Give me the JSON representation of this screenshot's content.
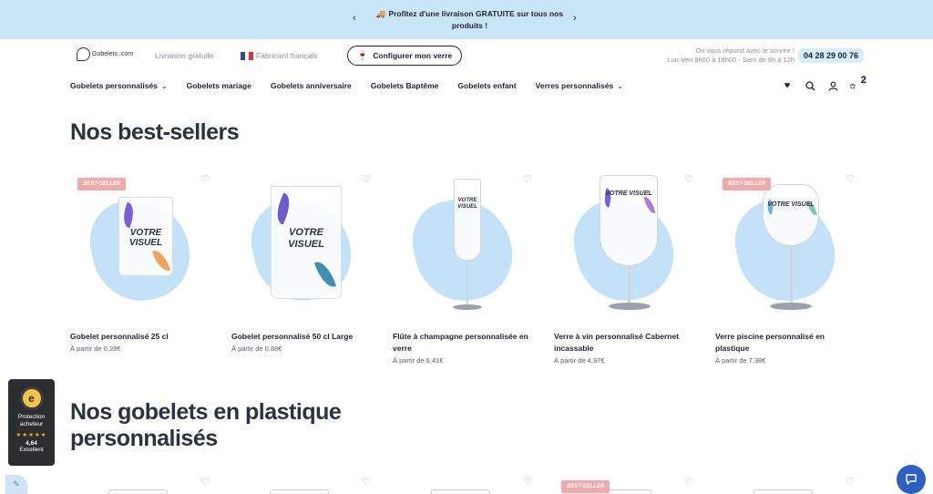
{
  "banner": {
    "message": "Profitez d'une livraison GRATUITE sur tous nos produits !",
    "prev_icon": "chevron-left-icon",
    "next_icon": "chevron-right-icon",
    "truck_icon": "truck-icon"
  },
  "header": {
    "logo_text": "Gobelets .com",
    "free_shipping": "Livraison gratuite",
    "made_in_france": "Fabricant français",
    "configure_button": "Configurer mon verre",
    "help_line1": "On vous répond avec le sourire !",
    "help_line2": "Lun-Ven 9h00 à 18h00 - Sam de 9h à 12h",
    "phone": "04 28 29 00 76"
  },
  "nav": {
    "items": [
      "Gobelets personnalisés",
      "Gobelets mariage",
      "Gobelets anniversaire",
      "Gobelets Baptême",
      "Gobelets enfant",
      "Verres personnalisés"
    ],
    "cart_count": "2"
  },
  "sections": {
    "best_sellers_title": "Nos best-sellers",
    "plastic_title_line1": "Nos gobelets en plastique",
    "plastic_title_line2": "personnalisés"
  },
  "products": [
    {
      "name": "Gobelet personnalisé 25 cl",
      "price": "À partir de 0,28€",
      "badge": "BEST-SELLER",
      "visual": "VOTRE VISUEL"
    },
    {
      "name": "Gobelet personnalisé 50 cl Large",
      "price": "À partir de 0,88€",
      "badge": "",
      "visual": "VOTRE VISUEL"
    },
    {
      "name": "Flûte à champagne personnalisée en verre",
      "price": "À partir de 6,41€",
      "badge": "",
      "visual": "VOTRE VISUEL"
    },
    {
      "name": "Verre à vin personnalisé Cabernet incassable",
      "price": "À partir de 4,97€",
      "badge": "",
      "visual": "VOTRE VISUEL"
    },
    {
      "name": "Verre piscine personnalisé en plastique",
      "price": "À partir de 7,38€",
      "badge": "BEST-SELLER",
      "visual": "VOTRE VISUEL"
    }
  ],
  "bottom_badge": "BEST-SELLER",
  "trust": {
    "line1": "Protection",
    "line2": "acheteur",
    "stars": "★★★★★",
    "score": "4,64",
    "label": "Excellent"
  },
  "colors": {
    "banner_bg": "#c9e6f8",
    "accent_blue": "#2e5fc2",
    "badge_pink": "#f2a9a7"
  }
}
